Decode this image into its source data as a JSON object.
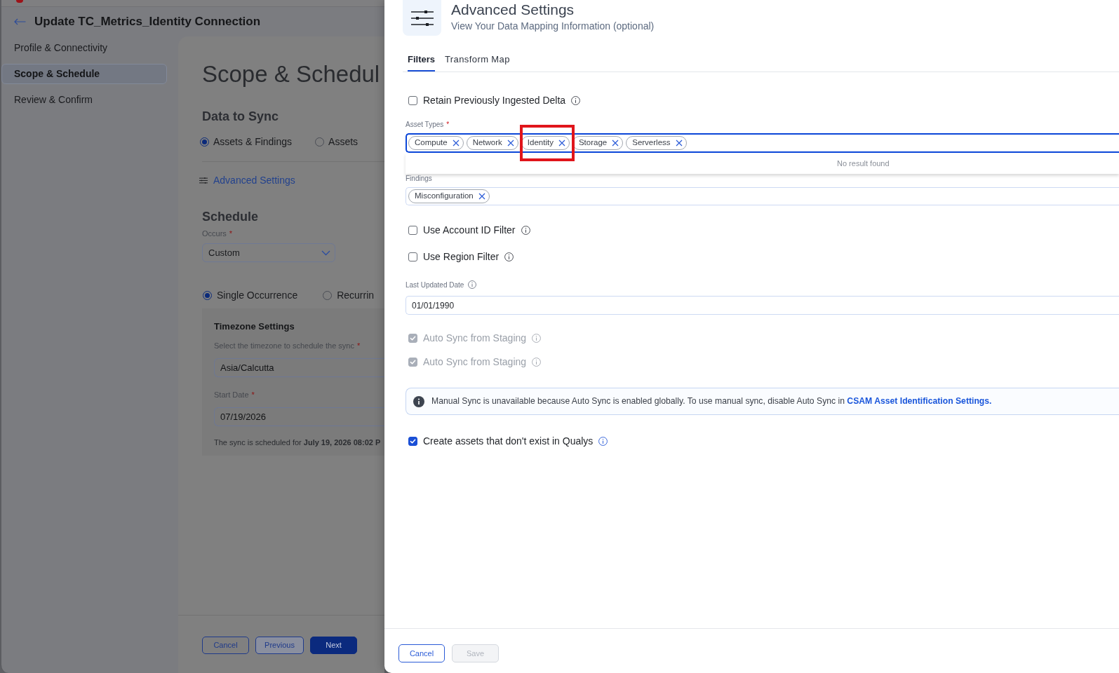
{
  "app": {
    "title": "Update TC_Metrics_Identity Connection",
    "steps": [
      {
        "label": "Profile & Connectivity",
        "selected": false
      },
      {
        "label": "Scope & Schedule",
        "selected": true
      },
      {
        "label": "Review & Confirm",
        "selected": false
      }
    ],
    "main": {
      "heading": "Scope & Schedul",
      "data_to_sync": {
        "title": "Data to Sync",
        "options": [
          {
            "label": "Assets & Findings",
            "selected": true
          },
          {
            "label": "Assets",
            "selected": false
          }
        ]
      },
      "advanced_link": "Advanced Settings",
      "schedule": {
        "title": "Schedule",
        "occurs": {
          "label": "Occurs",
          "required_mark": "*",
          "value": "Custom"
        },
        "options": [
          {
            "label": "Single Occurrence",
            "selected": true
          },
          {
            "label": "Recurrin",
            "selected": false
          }
        ],
        "timezone_settings": {
          "title": "Timezone Settings",
          "timezone": {
            "label": "Select the timezone to schedule the sync",
            "required_mark": "*",
            "value": "Asia/Calcutta"
          },
          "start_date": {
            "label": "Start Date",
            "required_mark": "*",
            "value": "07/19/2026"
          },
          "note": "The sync is scheduled for **July 19, 2026 08:02 P**"
        }
      },
      "buttons": [
        {
          "label": "Cancel",
          "kind": "outline"
        },
        {
          "label": "Previous",
          "kind": "secondary"
        },
        {
          "label": "Next",
          "kind": "primary"
        }
      ]
    }
  },
  "drawer": {
    "title": "Advanced Settings",
    "subtitle": "View Your Data Mapping Information (optional)",
    "tabs": [
      {
        "label": "Filters",
        "selected": true
      },
      {
        "label": "Transform Map",
        "selected": false
      }
    ],
    "fields": [
      {
        "kind": "checkbox",
        "label": "Retain Previously Ingested Delta",
        "checked": false,
        "disabled": false
      },
      {
        "kind": "multiselect",
        "label": "Asset Types",
        "required_mark": "*",
        "focused": true,
        "chips": [
          {
            "label": "Compute",
            "highlighted": false
          },
          {
            "label": "Network",
            "highlighted": false
          },
          {
            "label": "Identity",
            "highlighted": true
          },
          {
            "label": "Storage",
            "highlighted": false
          },
          {
            "label": "Serverless",
            "highlighted": false
          }
        ],
        "dropdown": "No result found"
      },
      {
        "kind": "multiselect",
        "label": "Findings",
        "focused": false,
        "chips": [
          {
            "label": "Misconfiguration",
            "highlighted": false
          }
        ]
      },
      {
        "kind": "checkbox",
        "label": "Use Account ID Filter",
        "checked": false,
        "disabled": false
      },
      {
        "kind": "checkbox",
        "label": "Use Region Filter",
        "checked": false,
        "disabled": false
      },
      {
        "kind": "date",
        "label": "Last Updated Date",
        "value": "01/01/1990"
      },
      {
        "kind": "checkbox",
        "label": "Auto Sync from Staging",
        "checked": true,
        "disabled": true
      },
      {
        "kind": "checkbox",
        "label": "Auto Sync from Staging",
        "checked": true,
        "disabled": true
      },
      {
        "kind": "banner",
        "text": "Manual Sync is unavailable because Auto Sync is enabled globally. To use manual sync, disable Auto Sync in ",
        "link": "CSAM Asset Identification Settings."
      },
      {
        "kind": "checkbox",
        "label": "Create assets that don't exist in Qualys",
        "checked": true,
        "disabled": false
      }
    ],
    "buttons": [
      {
        "label": "Cancel",
        "disabled": false
      },
      {
        "label": "Save",
        "disabled": true
      }
    ]
  }
}
